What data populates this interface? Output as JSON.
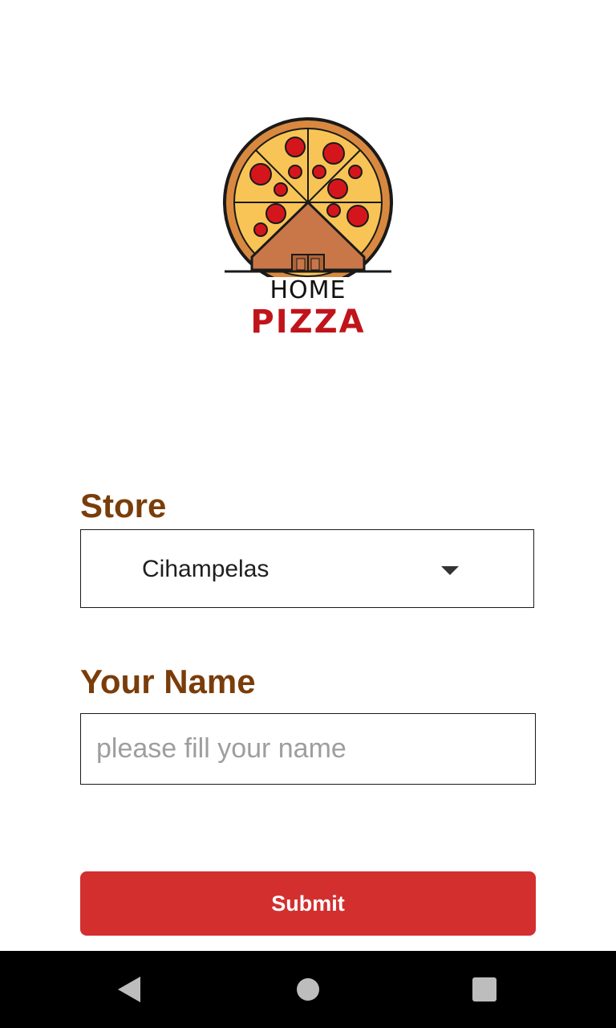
{
  "logo": {
    "icon": "pizza-house-icon",
    "line1": "HOME",
    "line2": "PIZZA",
    "colors": {
      "crust": "#d8893f",
      "cheese": "#f9c456",
      "pepperoni": "#d4161c",
      "house": "#c97748",
      "text_accent": "#c0141b"
    }
  },
  "form": {
    "store_label": "Store",
    "store_selected": "Cihampelas",
    "name_label": "Your Name",
    "name_value": "",
    "name_placeholder": "please fill your name",
    "submit_label": "Submit"
  },
  "theme": {
    "label_color": "#7a3d0a",
    "button_color": "#d32f2f"
  },
  "navbar": {
    "back_icon": "back-triangle-icon",
    "home_icon": "home-circle-icon",
    "recents_icon": "recents-square-icon"
  }
}
